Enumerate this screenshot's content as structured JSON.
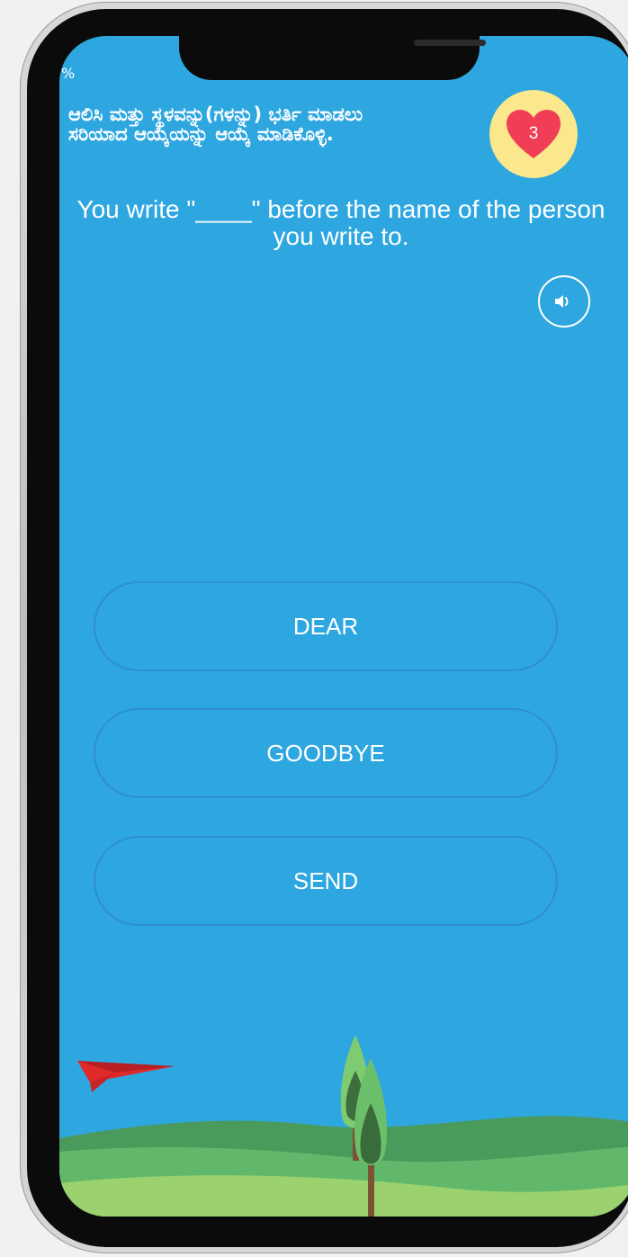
{
  "header": {
    "progress_label": "%",
    "instruction": "ಆಲಿಸಿ ಮತ್ತು ಸ್ಥಳವನ್ನು(ಗಳನ್ನು) ಭರ್ತಿ ಮಾಡಲು ಸರಿಯಾದ ಆಯ್ಕೆಯನ್ನು ಆಯ್ಕೆ ಮಾಡಿಕೊಳ್ಳಿ.",
    "lives": "3"
  },
  "question": {
    "text": "You write \"____\" before the name of the person you write to."
  },
  "options": [
    {
      "label": "DEAR"
    },
    {
      "label": "GOODBYE"
    },
    {
      "label": "SEND"
    }
  ],
  "icons": {
    "lives": "heart-icon",
    "audio": "speaker-icon",
    "decoration": "paper-plane-icon"
  },
  "colors": {
    "screen_background": "#2ea7e0",
    "lives_badge": "#fbe78c",
    "heart": "#ef3e56",
    "option_border": "#2f8ecf"
  }
}
